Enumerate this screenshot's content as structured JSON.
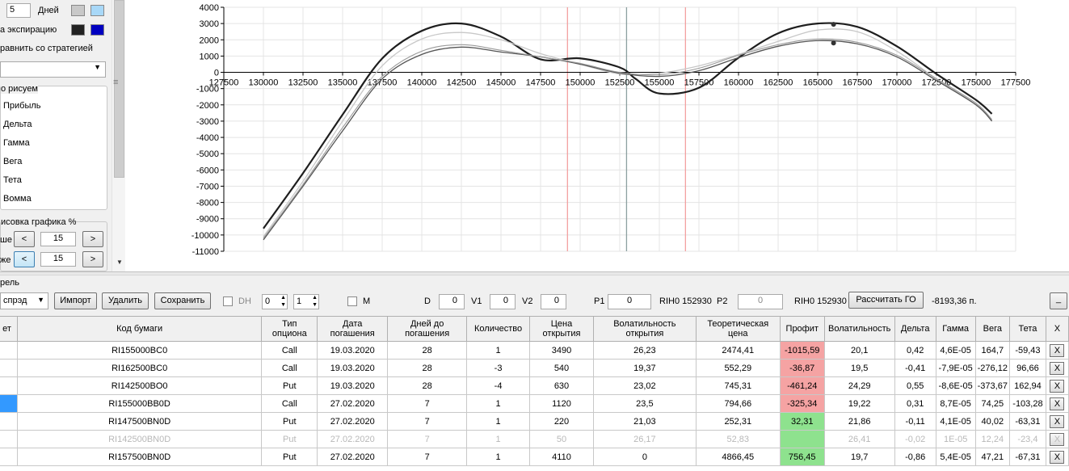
{
  "left_panel": {
    "days_value": "5",
    "days_label": "Дней",
    "expiration_label": "а экспирацию",
    "compare_label": "равнить со стратегией",
    "graph_group_title": "о рисуем",
    "radio_items": [
      "Прибыль",
      "Дельта",
      "Гамма",
      "Вега",
      "Тета",
      "Вомма"
    ],
    "draw_group_title": "исовка графика %",
    "upper_label": "ше",
    "lower_label": "же",
    "upper_value": "15",
    "lower_value": "15",
    "colors": {
      "days_light": "#c8c8c8",
      "days_blue": "#a8d8f8",
      "exp_dark": "#222222",
      "exp_blue": "#0000c0"
    }
  },
  "chart_data": {
    "type": "line",
    "x_ticks": [
      "127500",
      "130000",
      "132500",
      "135000",
      "137500",
      "140000",
      "142500",
      "145000",
      "147500",
      "150000",
      "152500",
      "155000",
      "157500",
      "160000",
      "162500",
      "165000",
      "167500",
      "170000",
      "172500",
      "175000",
      "177500"
    ],
    "y_ticks": [
      "4000",
      "3000",
      "2000",
      "1000",
      "0",
      "-1000",
      "-2000",
      "-3000",
      "-4000",
      "-5000",
      "-6000",
      "-7000",
      "-8000",
      "-9000",
      "-10000",
      "-11000"
    ],
    "xlim": [
      127500,
      177500
    ],
    "ylim": [
      -11000,
      4000
    ],
    "grid": true,
    "series": [
      {
        "color": "#1e1e1e",
        "width": 2.2,
        "points": [
          [
            130000,
            -9600
          ],
          [
            132500,
            -6200
          ],
          [
            135000,
            -2600
          ],
          [
            137500,
            850
          ],
          [
            140000,
            2550
          ],
          [
            142500,
            3000
          ],
          [
            145000,
            2200
          ],
          [
            147500,
            800
          ],
          [
            150000,
            860
          ],
          [
            152500,
            300
          ],
          [
            153500,
            -400
          ],
          [
            155000,
            -1300
          ],
          [
            157500,
            -950
          ],
          [
            160000,
            900
          ],
          [
            162500,
            2400
          ],
          [
            165000,
            3000
          ],
          [
            167500,
            2800
          ],
          [
            170000,
            1600
          ],
          [
            172500,
            -100
          ],
          [
            175000,
            -1700
          ],
          [
            176000,
            -2550
          ]
        ]
      },
      {
        "color": "#c8c8c8",
        "width": 1.3,
        "points": [
          [
            130000,
            -10100
          ],
          [
            132500,
            -6700
          ],
          [
            135000,
            -3000
          ],
          [
            137500,
            400
          ],
          [
            140000,
            2050
          ],
          [
            142500,
            2450
          ],
          [
            145000,
            2000
          ],
          [
            147500,
            1150
          ],
          [
            150000,
            500
          ],
          [
            152500,
            -100
          ],
          [
            155000,
            -50
          ],
          [
            157500,
            400
          ],
          [
            160000,
            1100
          ],
          [
            162500,
            1900
          ],
          [
            165000,
            2600
          ],
          [
            167500,
            2500
          ],
          [
            170000,
            1300
          ],
          [
            172500,
            -400
          ],
          [
            175000,
            -2000
          ],
          [
            176000,
            -2950
          ]
        ]
      },
      {
        "color": "#555555",
        "width": 1.3,
        "points": [
          [
            130000,
            -10300
          ],
          [
            132500,
            -7000
          ],
          [
            135000,
            -3600
          ],
          [
            137500,
            -400
          ],
          [
            140000,
            1100
          ],
          [
            142500,
            1550
          ],
          [
            145000,
            1250
          ],
          [
            147500,
            950
          ],
          [
            150000,
            500
          ],
          [
            152500,
            -50
          ],
          [
            155000,
            -250
          ],
          [
            157500,
            100
          ],
          [
            160000,
            900
          ],
          [
            162500,
            1600
          ],
          [
            165000,
            1950
          ],
          [
            167500,
            1750
          ],
          [
            170000,
            950
          ],
          [
            172500,
            -500
          ],
          [
            175000,
            -2000
          ],
          [
            176000,
            -3000
          ]
        ]
      },
      {
        "color": "#9a9a9a",
        "width": 1.1,
        "points": [
          [
            130000,
            -10200
          ],
          [
            132500,
            -6900
          ],
          [
            135000,
            -3400
          ],
          [
            137500,
            -250
          ],
          [
            140000,
            1300
          ],
          [
            142500,
            1700
          ],
          [
            145000,
            1350
          ],
          [
            147500,
            950
          ],
          [
            150000,
            550
          ],
          [
            152500,
            0
          ],
          [
            155000,
            -150
          ],
          [
            157500,
            250
          ],
          [
            160000,
            1050
          ],
          [
            162500,
            1700
          ],
          [
            165000,
            2050
          ],
          [
            167500,
            1850
          ],
          [
            170000,
            1050
          ],
          [
            172500,
            -400
          ],
          [
            175000,
            -1900
          ],
          [
            176000,
            -2900
          ]
        ]
      }
    ],
    "markers": [
      [
        166000,
        2950
      ],
      [
        166000,
        1800
      ]
    ],
    "vlines": [
      {
        "x": 149200,
        "color": "#f3a0a0"
      },
      {
        "x": 152930,
        "color": "#8ca0a0"
      },
      {
        "x": 156650,
        "color": "#f3a0a0"
      }
    ]
  },
  "toolbar": {
    "portfolio_label": "рель",
    "strategy_value": "спрэд",
    "import_label": "Импорт",
    "delete_label": "Удалить",
    "save_label": "Сохранить",
    "dh_label": "DH",
    "spin1_value": "0",
    "spin2_value": "1",
    "m_label": "M",
    "d_label": "D",
    "d_value": "0",
    "v1_label": "V1",
    "v1_value": "0",
    "v2_label": "V2",
    "v2_value": "0",
    "p1_label": "P1",
    "p1_value": "0",
    "p1_ticker": "RIH0 152930",
    "p2_label": "P2",
    "p2_value": "0",
    "p2_ticker": "RIH0 152930",
    "calc_label": "Рассчитать ГО",
    "go_value": "-8193,36 п.",
    "minimize_label": "_"
  },
  "table": {
    "headers": [
      "ет",
      "Код бумаги",
      "Тип опциона",
      "Дата погашения",
      "Дней до погашения",
      "Количество",
      "Цена открытия",
      "Волатильность открытия",
      "Теоретическая цена",
      "Профит",
      "Волатильность",
      "Дельта",
      "Гамма",
      "Вега",
      "Тета",
      "X"
    ],
    "rows": [
      {
        "code": "RI155000BC0",
        "type": "Call",
        "date": "19.03.2020",
        "days": "28",
        "qty": "1",
        "price": "3490",
        "vol_open": "26,23",
        "theo": "2474,41",
        "profit": "-1015,59",
        "vol": "20,1",
        "delta": "0,42",
        "gamma": "4,6E-05",
        "vega": "164,7",
        "theta": "-59,43",
        "x": "X",
        "profit_sign": "neg",
        "disabled": false
      },
      {
        "code": "RI162500BC0",
        "type": "Call",
        "date": "19.03.2020",
        "days": "28",
        "qty": "-3",
        "price": "540",
        "vol_open": "19,37",
        "theo": "552,29",
        "profit": "-36,87",
        "vol": "19,5",
        "delta": "-0,41",
        "gamma": "-7,9E-05",
        "vega": "-276,12",
        "theta": "96,66",
        "x": "X",
        "profit_sign": "neg",
        "disabled": false
      },
      {
        "code": "RI142500BO0",
        "type": "Put",
        "date": "19.03.2020",
        "days": "28",
        "qty": "-4",
        "price": "630",
        "vol_open": "23,02",
        "theo": "745,31",
        "profit": "-461,24",
        "vol": "24,29",
        "delta": "0,55",
        "gamma": "-8,6E-05",
        "vega": "-373,67",
        "theta": "162,94",
        "x": "X",
        "profit_sign": "neg",
        "disabled": false
      },
      {
        "code": "RI155000BB0D",
        "type": "Call",
        "date": "27.02.2020",
        "days": "7",
        "qty": "1",
        "price": "1120",
        "vol_open": "23,5",
        "theo": "794,66",
        "profit": "-325,34",
        "vol": "19,22",
        "delta": "0,31",
        "gamma": "8,7E-05",
        "vega": "74,25",
        "theta": "-103,28",
        "x": "X",
        "profit_sign": "neg",
        "disabled": false
      },
      {
        "code": "RI147500BN0D",
        "type": "Put",
        "date": "27.02.2020",
        "days": "7",
        "qty": "1",
        "price": "220",
        "vol_open": "21,03",
        "theo": "252,31",
        "profit": "32,31",
        "vol": "21,86",
        "delta": "-0,11",
        "gamma": "4,1E-05",
        "vega": "40,02",
        "theta": "-63,31",
        "x": "X",
        "profit_sign": "pos",
        "disabled": false
      },
      {
        "code": "RI142500BN0D",
        "type": "Put",
        "date": "27.02.2020",
        "days": "7",
        "qty": "1",
        "price": "50",
        "vol_open": "26,17",
        "theo": "52,83",
        "profit": "",
        "vol": "26,41",
        "delta": "-0,02",
        "gamma": "1E-05",
        "vega": "12,24",
        "theta": "-23,4",
        "x": "X",
        "profit_sign": "pos",
        "disabled": true
      },
      {
        "code": "RI157500BN0D",
        "type": "Put",
        "date": "27.02.2020",
        "days": "7",
        "qty": "1",
        "price": "4110",
        "vol_open": "0",
        "theo": "4866,45",
        "profit": "756,45",
        "vol": "19,7",
        "delta": "-0,86",
        "gamma": "5,4E-05",
        "vega": "47,21",
        "theta": "-67,31",
        "x": "X",
        "profit_sign": "pos",
        "disabled": false
      }
    ]
  }
}
